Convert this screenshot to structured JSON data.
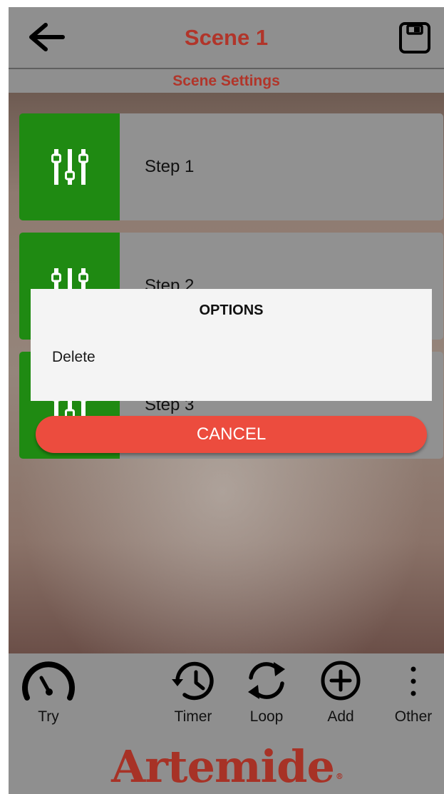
{
  "header": {
    "title": "Scene 1",
    "subtitle": "Scene Settings",
    "back_icon": "arrow-left-icon",
    "save_icon": "floppy-disk-icon",
    "title_color": "#b1352a"
  },
  "steps": [
    {
      "label": "Step 1",
      "icon": "sliders-icon"
    },
    {
      "label": "Step 2",
      "icon": "sliders-icon"
    },
    {
      "label": "Step 3",
      "icon": "sliders-icon"
    }
  ],
  "dialog": {
    "title": "OPTIONS",
    "options": [
      "Delete"
    ],
    "cancel_label": "CANCEL",
    "cancel_color": "#ec4c3e"
  },
  "toolbar": {
    "items": [
      {
        "label": "Try",
        "icon": "speedometer-icon"
      },
      {
        "label": "Timer",
        "icon": "history-clock-icon"
      },
      {
        "label": "Loop",
        "icon": "refresh-loop-icon"
      },
      {
        "label": "Add",
        "icon": "plus-circle-icon"
      },
      {
        "label": "Other",
        "icon": "more-vertical-icon"
      }
    ]
  },
  "brand": {
    "logo_text": "Artemide",
    "logo_mark": "®",
    "logo_color": "#a73226"
  },
  "colors": {
    "step_icon_bg": "#1f8a12",
    "step_body_bg": "#919191",
    "toolbar_bg": "#8f8f8f"
  }
}
